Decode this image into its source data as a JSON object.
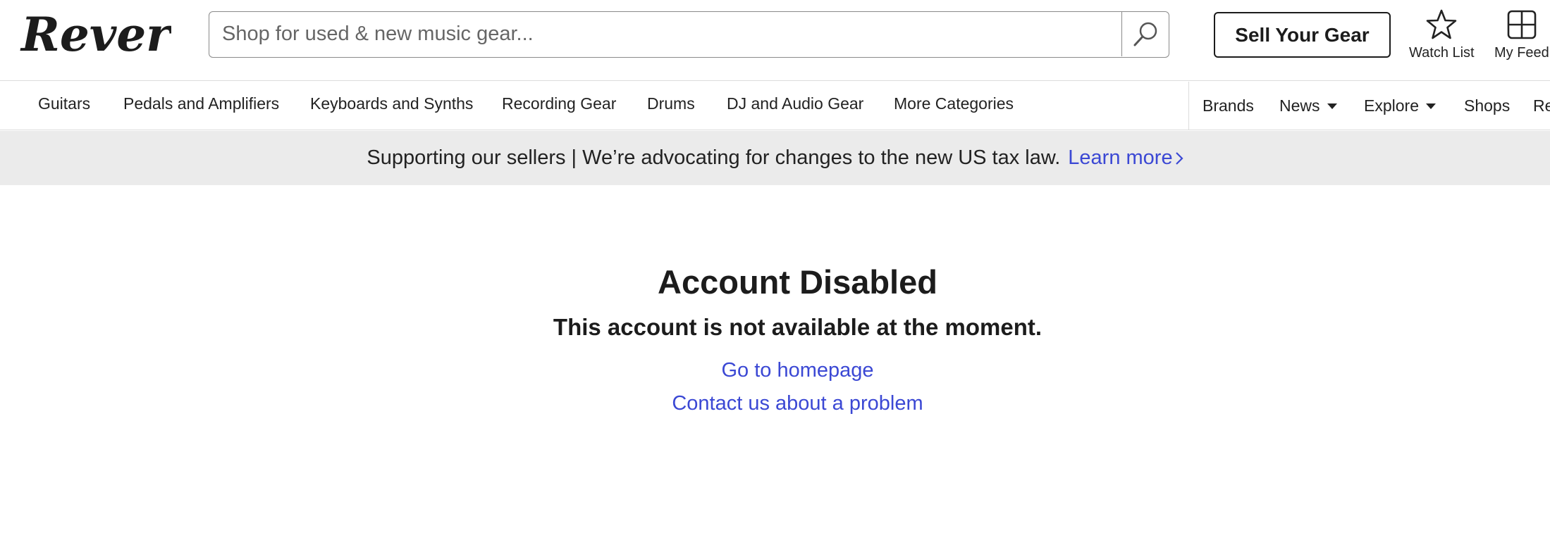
{
  "header": {
    "logo_text": "Reverb",
    "search_placeholder": "Shop for used & new music gear...",
    "sell_label": "Sell Your Gear",
    "watch_label": "Watch List",
    "feed_label": "My Feed"
  },
  "nav": {
    "categories": [
      "Guitars",
      "Pedals and Amplifiers",
      "Keyboards and Synths",
      "Recording Gear",
      "Drums",
      "DJ and Audio Gear",
      "More Categories"
    ],
    "right": [
      "Brands",
      "News",
      "Explore",
      "Shops",
      "Re"
    ]
  },
  "banner": {
    "text": "Supporting our sellers | We’re advocating for changes to the new US tax law.",
    "link": "Learn more"
  },
  "main": {
    "title": "Account Disabled",
    "subtitle": "This account is not available at the moment.",
    "link_home": "Go to homepage",
    "link_contact": "Contact us about a problem"
  },
  "colors": {
    "link": "#3b48d4",
    "banner_bg": "#ebebeb",
    "text": "#1c1c1c"
  },
  "icons": [
    "search-icon",
    "star-icon",
    "grid-icon",
    "chevron-right-icon",
    "caret-down-icon"
  ]
}
